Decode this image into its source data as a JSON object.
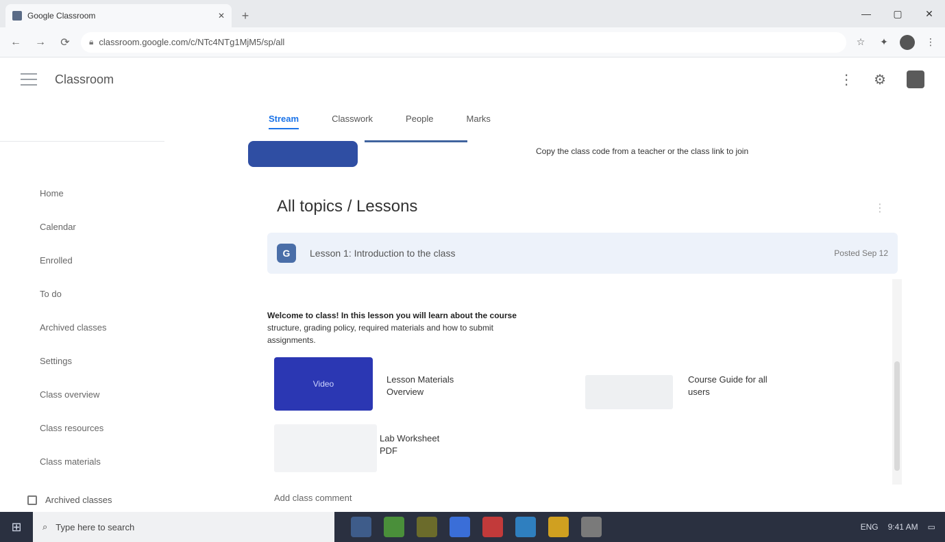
{
  "browser": {
    "tab_title": "Google Classroom",
    "new_tab_symbol": "+",
    "url": "classroom.google.com/c/NTc4NTg1MjM5/sp/all",
    "window_controls": [
      "—",
      "▢",
      "✕"
    ],
    "nav": [
      "←",
      "→",
      "⟳"
    ]
  },
  "app": {
    "brand": "Classroom",
    "header_icons": [
      "⋮",
      "⚙"
    ]
  },
  "sidebar": {
    "items": [
      {
        "label": "Home"
      },
      {
        "label": "Calendar"
      },
      {
        "label": "Enrolled"
      },
      {
        "label": "To do"
      },
      {
        "label": "Archived classes"
      },
      {
        "label": "Settings"
      },
      {
        "label": "Class overview"
      },
      {
        "label": "Class resources"
      },
      {
        "label": "Class materials"
      }
    ],
    "footer_label": "Archived classes"
  },
  "main": {
    "tabs": [
      {
        "label": "Stream",
        "active": true
      },
      {
        "label": "Classwork",
        "active": false
      },
      {
        "label": "People",
        "active": false
      },
      {
        "label": "Marks",
        "active": false
      }
    ],
    "promo_text": "Copy the class code from a teacher or the class link to join",
    "heading": "All topics / Lessons",
    "more": "⋮",
    "content_bar": {
      "icon_letter": "G",
      "title": "Lesson 1: Introduction to the class",
      "right": "Posted Sep 12"
    },
    "description": [
      "Welcome to class! In this lesson you will learn about the course",
      "structure, grading policy, required materials and how to submit",
      "assignments."
    ],
    "card1": {
      "image_label": "Video",
      "title_line1": "Lesson Materials",
      "title_line2": "Overview"
    },
    "card2": {
      "title_line1": "Course Guide for all",
      "title_line2": "users"
    },
    "card3": {
      "title_line1": "Lab Worksheet",
      "title_line2": "PDF"
    },
    "bottom_chip": "Add class comment"
  },
  "taskbar": {
    "start_symbol": "⊞",
    "search_placeholder": "Type here to search",
    "apps": [
      {
        "name": "file-explorer",
        "color": "#3e5c8a"
      },
      {
        "name": "browser",
        "color": "#4a8f3a"
      },
      {
        "name": "mail",
        "color": "#6b6b2b"
      },
      {
        "name": "store",
        "color": "#3a6ed8"
      },
      {
        "name": "media",
        "color": "#c23a3a"
      },
      {
        "name": "photos",
        "color": "#2f7fbf"
      },
      {
        "name": "settings",
        "color": "#d0a020"
      },
      {
        "name": "notes",
        "color": "#7a7a7a"
      }
    ],
    "tray_text": "ENG",
    "time": "9:41 AM"
  }
}
